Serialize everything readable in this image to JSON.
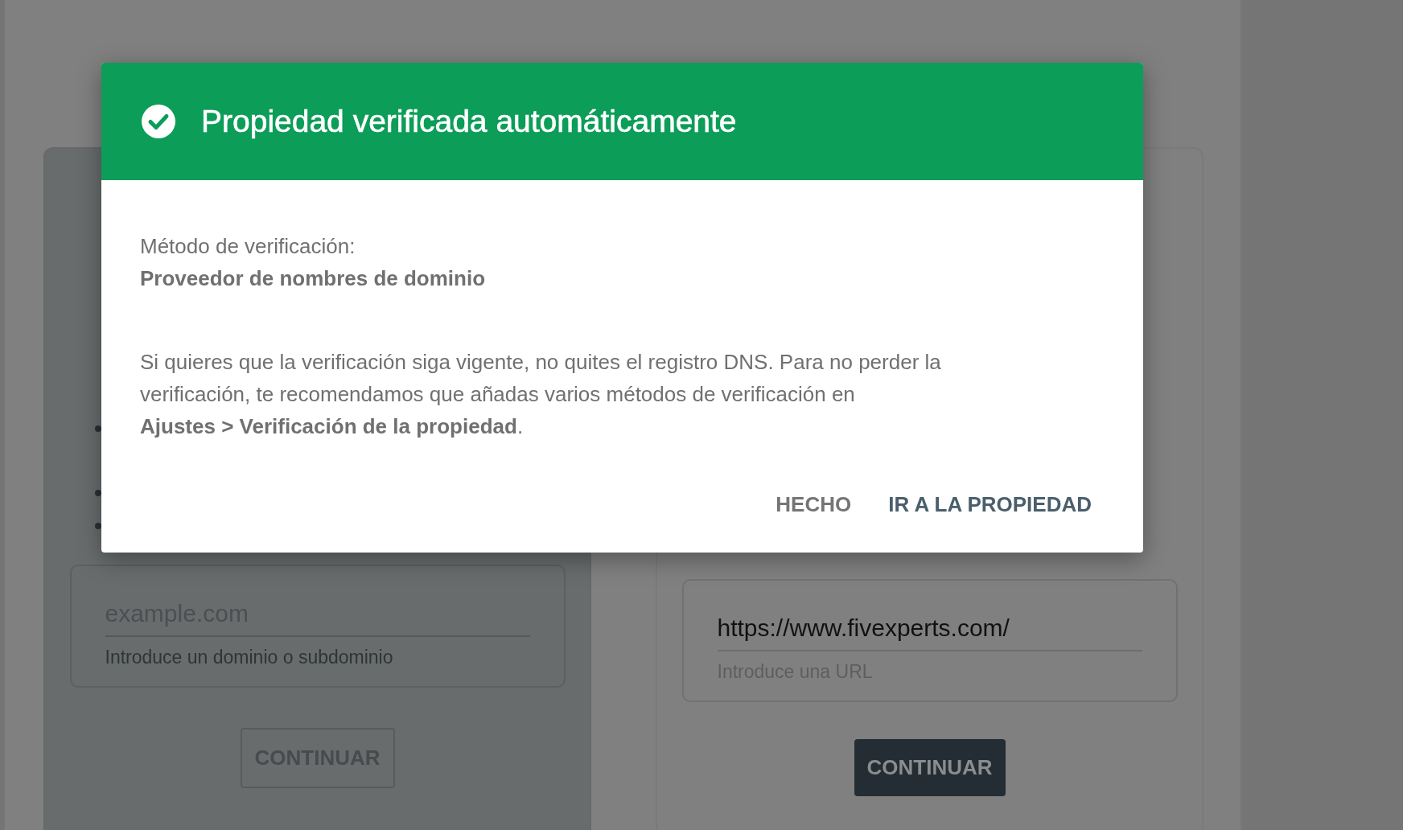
{
  "cards": [
    {
      "kind": "domain",
      "field": {
        "placeholder": "example.com",
        "helper": "Introduce un dominio o subdominio"
      },
      "button": {
        "label": "CONTINUAR",
        "disabled": true
      }
    },
    {
      "kind": "url",
      "field": {
        "value": "https://www.fivexperts.com/",
        "helper": "Introduce una URL"
      },
      "button": {
        "label": "CONTINUAR",
        "disabled": false
      }
    }
  ],
  "dialog": {
    "title": "Propiedad verificada automáticamente",
    "method_label": "Método de verificación:",
    "method": "Proveedor de nombres de dominio",
    "message": "Si quieres que la verificación siga vigente, no quites el registro DNS. Para no perder la verificación, te recomendamos que añadas varios métodos de verificación en **Ajustes > Verificación de la propiedad**.",
    "actions": [
      {
        "label": "HECHO",
        "kind": "secondary"
      },
      {
        "label": "IR A LA PROPIEDAD",
        "kind": "primary"
      }
    ]
  }
}
